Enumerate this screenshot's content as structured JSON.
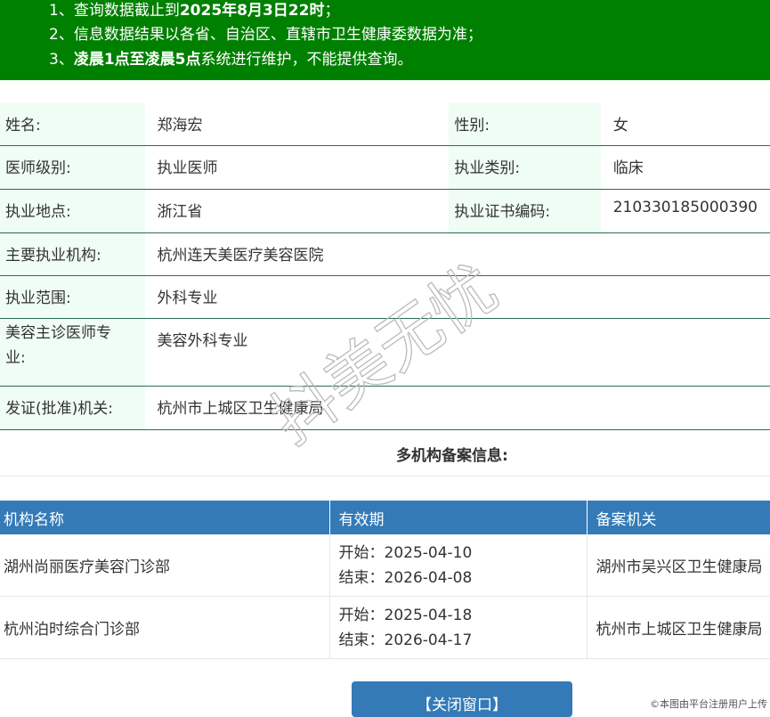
{
  "notice": {
    "line1_prefix": "1、查询数据截止到",
    "line1_bold": "2025年8月3日22时",
    "line1_suffix": "；",
    "line2": "2、信息数据结果以各省、自治区、直辖市卫生健康委数据为准；",
    "line3_prefix": "3、",
    "line3_bold": "凌晨1点至凌晨5点",
    "line3_suffix": "系统进行维护，不能提供查询。"
  },
  "doctor": {
    "name_label": "姓名:",
    "name": "郑海宏",
    "gender_label": "性别:",
    "gender": "女",
    "level_label": "医师级别:",
    "level": "执业医师",
    "category_label": "执业类别:",
    "category": "临床",
    "location_label": "执业地点:",
    "location": "浙江省",
    "cert_label": "执业证书编码:",
    "cert": "210330185000390",
    "institution_label": "主要执业机构:",
    "institution": "杭州连天美医疗美容医院",
    "scope_label": "执业范围:",
    "scope": "外科专业",
    "cosmetic_label_1": "美容主诊医师专",
    "cosmetic_label_2": "业:",
    "cosmetic": "美容外科专业",
    "issuer_label": "发证(批准)机关:",
    "issuer": "杭州市上城区卫生健康局"
  },
  "multi": {
    "title": "多机构备案信息:",
    "headers": [
      "机构名称",
      "有效期",
      "备案机关"
    ],
    "rows": [
      {
        "name": "湖州尚丽医疗美容门诊部",
        "start": "开始：2025-04-10",
        "end": "结束：2026-04-08",
        "authority": "湖州市吴兴区卫生健康局"
      },
      {
        "name": "杭州泊时综合门诊部",
        "start": "开始：2025-04-18",
        "end": "结束：2026-04-17",
        "authority": "杭州市上城区卫生健康局"
      }
    ]
  },
  "close_button": "【关闭窗口】",
  "footer_note": "©本图由平台注册用户上传",
  "watermark": "抖美无忧"
}
